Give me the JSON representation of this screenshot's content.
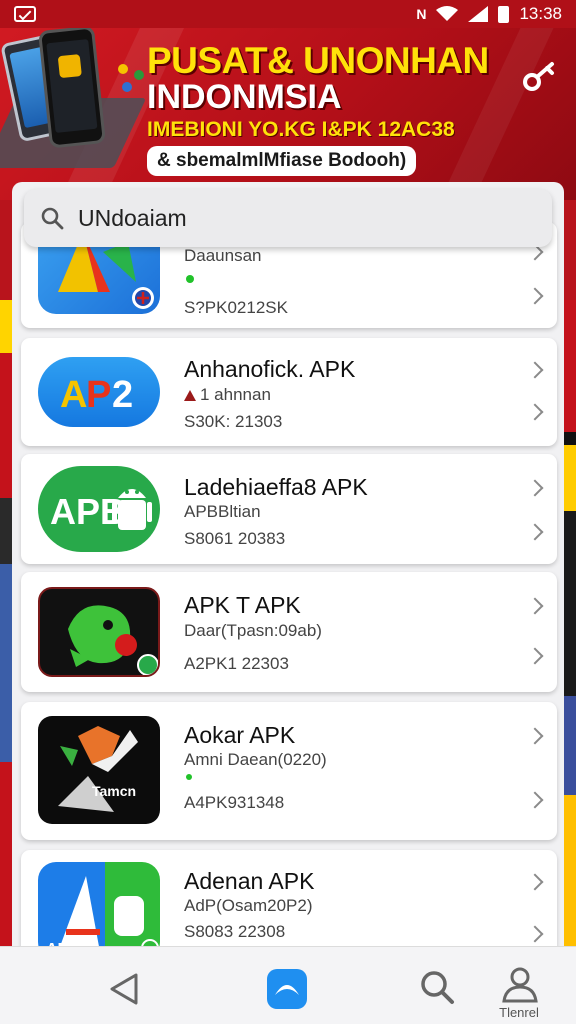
{
  "status_bar": {
    "time": "13:38"
  },
  "banner": {
    "title_line1": "PUSAT& UNONHAN",
    "title_line2": "INDONMSIA",
    "subtitle": "IMEBIONI YO.KG I&PK 12AC38",
    "tag": "& sbemalmlMfiase Bodooh)"
  },
  "search": {
    "value": "UNdoaiam"
  },
  "apps": [
    {
      "name": "",
      "meta": "Daaunsan",
      "size": "S?PK0212SK",
      "icon": "ap-blue-multicolor-icon"
    },
    {
      "name": "Anhanofick. APK",
      "meta": "1 ahnnan",
      "size": "S30K: 21303",
      "icon": "ap2-blue-icon"
    },
    {
      "name": "Ladehiaeffa8 APK",
      "meta": "APBBltian",
      "size": "S8061 20383",
      "icon": "apb-green-android-icon"
    },
    {
      "name": "APK T APK",
      "meta": "Daar(Tpasn:09ab)",
      "size": "A2PK1 22303",
      "icon": "green-bird-icon"
    },
    {
      "name": "Aokar APK",
      "meta": "Amni Daean(0220)",
      "size": "A4PK931348",
      "icon": "orange-fox-icon"
    },
    {
      "name": "Adenan APK",
      "meta": "AdP(Osam20P2)",
      "size": "S8083 22308",
      "icon": "ape-blue-green-icon"
    }
  ],
  "bottom_nav": {
    "profile_label": "Tlenrel"
  },
  "colors": {
    "banner_red": "#c4121b",
    "banner_yellow": "#ffe20a",
    "accent_blue": "#1f8ff0",
    "green": "#21c22a"
  }
}
